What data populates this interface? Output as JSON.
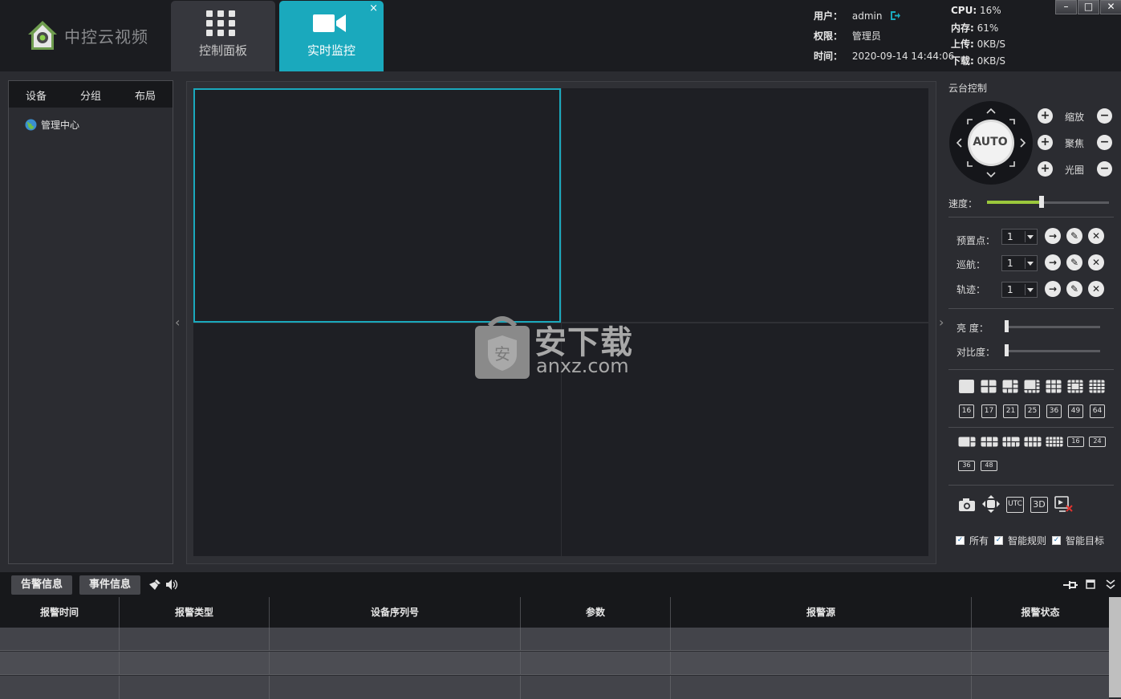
{
  "app": {
    "name": "中控云视频",
    "logo_icon": "house-camera-icon"
  },
  "nav": {
    "tabs": [
      {
        "label": "控制面板",
        "icon": "grid-icon"
      },
      {
        "label": "实时监控",
        "icon": "video-camera-icon",
        "close": "×"
      }
    ]
  },
  "session": {
    "user_label": "用户：",
    "user": "admin",
    "role_label": "权限：",
    "role": "管理员",
    "time_label": "时间：",
    "time": "2020-09-14 14:44:06"
  },
  "stats": {
    "cpu_label": "CPU:",
    "cpu": "16%",
    "mem_label": "内存:",
    "mem": "61%",
    "up_label": "上传:",
    "up": "0KB/S",
    "down_label": "下载:",
    "down": "0KB/S"
  },
  "window": {
    "min": "–",
    "max": "□",
    "close": "✕"
  },
  "left_panel": {
    "tabs": [
      "设备",
      "分组",
      "布局"
    ],
    "tree": [
      {
        "label": "管理中心",
        "icon": "globe-icon"
      }
    ]
  },
  "ptz": {
    "title": "云台控制",
    "auto": "AUTO",
    "zoom": "缩放",
    "focus": "聚焦",
    "iris": "光圈",
    "speed_label": "速度：",
    "speed_level": 0.45,
    "preset_label": "预置点：",
    "preset": "1",
    "cruise_label": "巡航：",
    "cruise": "1",
    "track_label": "轨迹：",
    "track": "1",
    "brightness_label": "亮  度：",
    "contrast_label": "对比度：",
    "layouts_row1": [
      "1",
      "4",
      "6",
      "8",
      "9",
      "13",
      "16"
    ],
    "layouts_row2": [
      "16",
      "17",
      "21",
      "25",
      "36",
      "49",
      "64"
    ],
    "layouts_row3_nums": [
      "16",
      "24"
    ],
    "layouts_row4": [
      "36",
      "48"
    ],
    "tools": [
      {
        "icon": "camera-icon"
      },
      {
        "icon": "move-icon"
      },
      {
        "label": "UTC"
      },
      {
        "label": "3D"
      },
      {
        "icon": "monitor-close-icon"
      }
    ],
    "filters": [
      "所有",
      "智能规则",
      "智能目标"
    ]
  },
  "bottom": {
    "tabs": [
      "告警信息",
      "事件信息"
    ],
    "icons": [
      "broom-icon",
      "speaker-icon"
    ],
    "right_icons": [
      "pin-icon",
      "window-icon",
      "collapse-icon"
    ]
  },
  "alarm_table": {
    "columns": [
      "报警时间",
      "报警类型",
      "设备序列号",
      "参数",
      "报警源",
      "报警状态"
    ],
    "rows": [
      [
        "",
        "",
        "",
        "",
        "",
        ""
      ],
      [
        "",
        "",
        "",
        "",
        "",
        ""
      ],
      [
        "",
        "",
        "",
        "",
        "",
        ""
      ]
    ]
  },
  "watermark": {
    "text": "安下载",
    "sub": "anxz.com"
  }
}
